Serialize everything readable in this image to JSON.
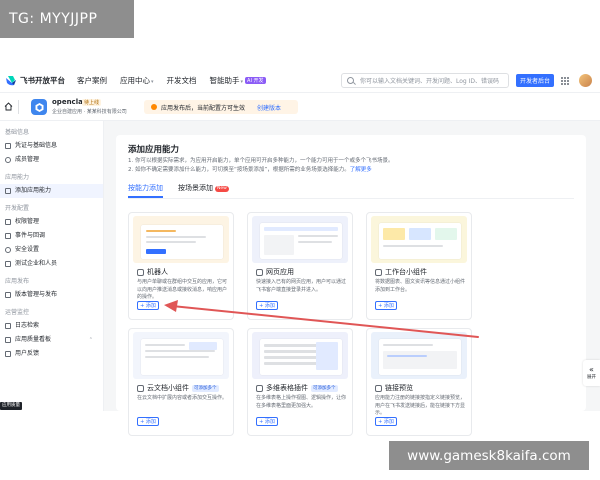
{
  "watermark_top": "TG: MYYJJPP",
  "watermark_bottom": "www.gamesk8kaifa.com",
  "topbar": {
    "brand": "飞书开放平台",
    "nav": [
      {
        "label": "客户案例"
      },
      {
        "label": "应用中心",
        "caret": "▾"
      },
      {
        "label": "开发文档"
      },
      {
        "label": "智能助手",
        "caret": "▾",
        "badge": "AI 开发"
      }
    ],
    "search_placeholder": "你可以输入文档关键词、开发问题、Log ID、错误码",
    "dev_button": "开发者后台"
  },
  "appbar": {
    "app_name": "openclaw",
    "app_tag": "待上线",
    "app_sub": "企业自建应用 · 某某科技有限公司",
    "notice": "应用发布后，当前配置方可生效",
    "notice_link": "创建版本"
  },
  "sidebar": {
    "groups": [
      {
        "title": "基础信息",
        "items": [
          {
            "label": "凭证与基础信息",
            "icon": "key-icon"
          },
          {
            "label": "成员管理",
            "icon": "user-icon"
          }
        ]
      },
      {
        "title": "应用能力",
        "items": [
          {
            "label": "添加应用能力",
            "icon": "grid-icon",
            "active": true
          }
        ]
      },
      {
        "title": "开发配置",
        "items": [
          {
            "label": "权限管理",
            "icon": "lock-icon"
          },
          {
            "label": "事件与回调",
            "icon": "event-icon"
          },
          {
            "label": "安全设置",
            "icon": "shield-icon"
          },
          {
            "label": "测试企业和人员",
            "icon": "test-icon"
          }
        ]
      },
      {
        "title": "应用发布",
        "items": [
          {
            "label": "版本管理与发布",
            "icon": "version-icon"
          }
        ]
      },
      {
        "title": "运营监控",
        "items": [
          {
            "label": "日志检索",
            "icon": "log-icon"
          },
          {
            "label": "应用质量看板",
            "icon": "chart-icon",
            "caret": "⌃"
          },
          {
            "label": "用户反馈",
            "icon": "feedback-icon"
          }
        ]
      }
    ],
    "tooltip": "应用质量"
  },
  "main": {
    "title": "添加应用能力",
    "desc_line1": "1. 你可以根据实际需求，为应用开启能力，单个应用可开启多种能力，一个能力可用于一个或多个飞书场景。",
    "desc_line2": "2. 如你不确定需要添加什么能力，可切换至“按场景添加”，根据所需的业务场景选择能力。",
    "desc_link": "了解更多",
    "tabs": [
      {
        "label": "按能力添加",
        "active": true
      },
      {
        "label": "按场景添加",
        "badge": "New"
      }
    ],
    "cards": [
      {
        "title": "机器人",
        "icon": "robot-icon",
        "desc": "与用户单聊或在群组中交互的应用，它可以向用户推送消息或接收消息，响应用户的操作。",
        "button": "+ 添加",
        "bg": "#fdf4e4"
      },
      {
        "title": "网页应用",
        "icon": "web-icon",
        "desc": "快速接入已有的网页应用，用户可以通过飞书客户端直接登录并进入。",
        "button": "+ 添加",
        "bg": "#eef1fb"
      },
      {
        "title": "工作台小组件",
        "icon": "widget-icon",
        "desc": "将数据图表、图文资讯等信息通过小组件添加到工作台。",
        "button": "+ 添加",
        "bg": "#fbf6dc"
      },
      {
        "title": "云文档小组件",
        "icon": "doc-icon",
        "tag": "可添加多个",
        "desc": "在云文档中扩展内容或者添加交互操作。",
        "button": "+ 添加",
        "bg": "#f2f5fc"
      },
      {
        "title": "多维表格插件",
        "icon": "table-icon",
        "tag": "可添加多个",
        "desc": "在多维表格上操作视图、逻辑操作，让你在多维表格里面更加强大。",
        "button": "+ 添加",
        "bg": "#eef0fb"
      },
      {
        "title": "链接预览",
        "icon": "link-icon",
        "desc": "应用能力注册的链接按指定义链接预览，用户在飞书发送链接后，能在链接下方显示。",
        "button": "+ 添加",
        "bg": "#eaf1fb"
      }
    ]
  },
  "collapse": {
    "icon": "«",
    "label": "展开"
  },
  "colors": {
    "accent": "#3370ff",
    "arrow": "#e05656"
  }
}
